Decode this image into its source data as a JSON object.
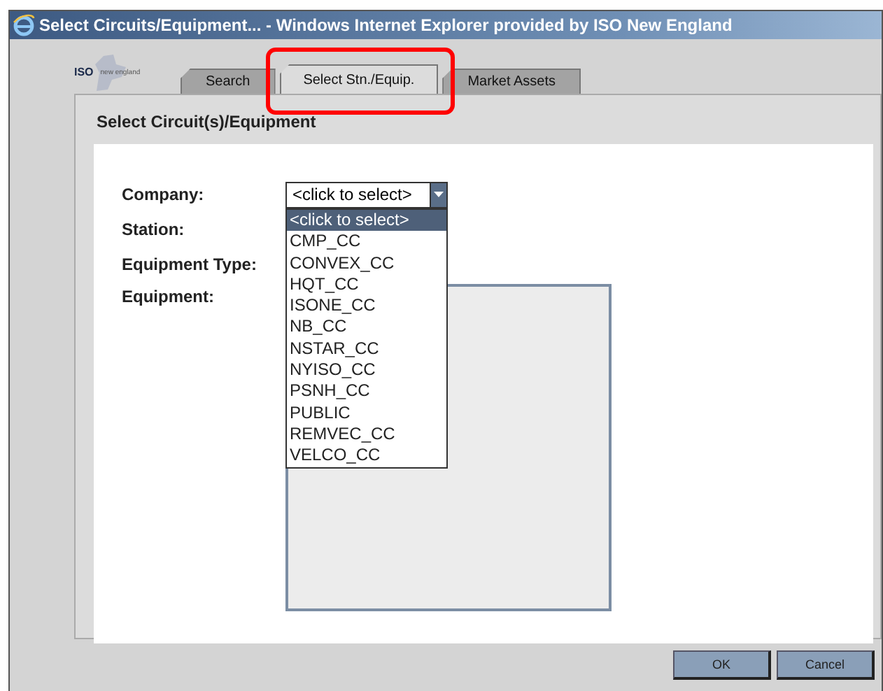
{
  "window": {
    "title": "Select Circuits/Equipment... - Windows Internet Explorer provided by ISO New England"
  },
  "logo": {
    "abbr": "ISO",
    "tagline": "new england"
  },
  "tabs": [
    {
      "label": "Search",
      "selected": false,
      "highlighted": false
    },
    {
      "label": "Select Stn./Equip.",
      "selected": true,
      "highlighted": true
    },
    {
      "label": "Market Assets",
      "selected": false,
      "highlighted": false
    }
  ],
  "heading": "Select Circuit(s)/Equipment",
  "form": {
    "company": {
      "label": "Company:",
      "value": "<click to select>",
      "expanded": true,
      "options": [
        {
          "label": "<click to select>",
          "selected": true
        },
        {
          "label": "CMP_CC",
          "selected": false
        },
        {
          "label": "CONVEX_CC",
          "selected": false
        },
        {
          "label": "HQT_CC",
          "selected": false
        },
        {
          "label": "ISONE_CC",
          "selected": false
        },
        {
          "label": "NB_CC",
          "selected": false
        },
        {
          "label": "NSTAR_CC",
          "selected": false
        },
        {
          "label": "NYISO_CC",
          "selected": false
        },
        {
          "label": "PSNH_CC",
          "selected": false
        },
        {
          "label": "PUBLIC",
          "selected": false
        },
        {
          "label": "REMVEC_CC",
          "selected": false
        },
        {
          "label": "VELCO_CC",
          "selected": false
        }
      ]
    },
    "station": {
      "label": "Station:"
    },
    "equipment_type": {
      "label": "Equipment Type:"
    },
    "equipment": {
      "label": "Equipment:"
    }
  },
  "buttons": [
    {
      "label": "OK"
    },
    {
      "label": "Cancel"
    }
  ]
}
